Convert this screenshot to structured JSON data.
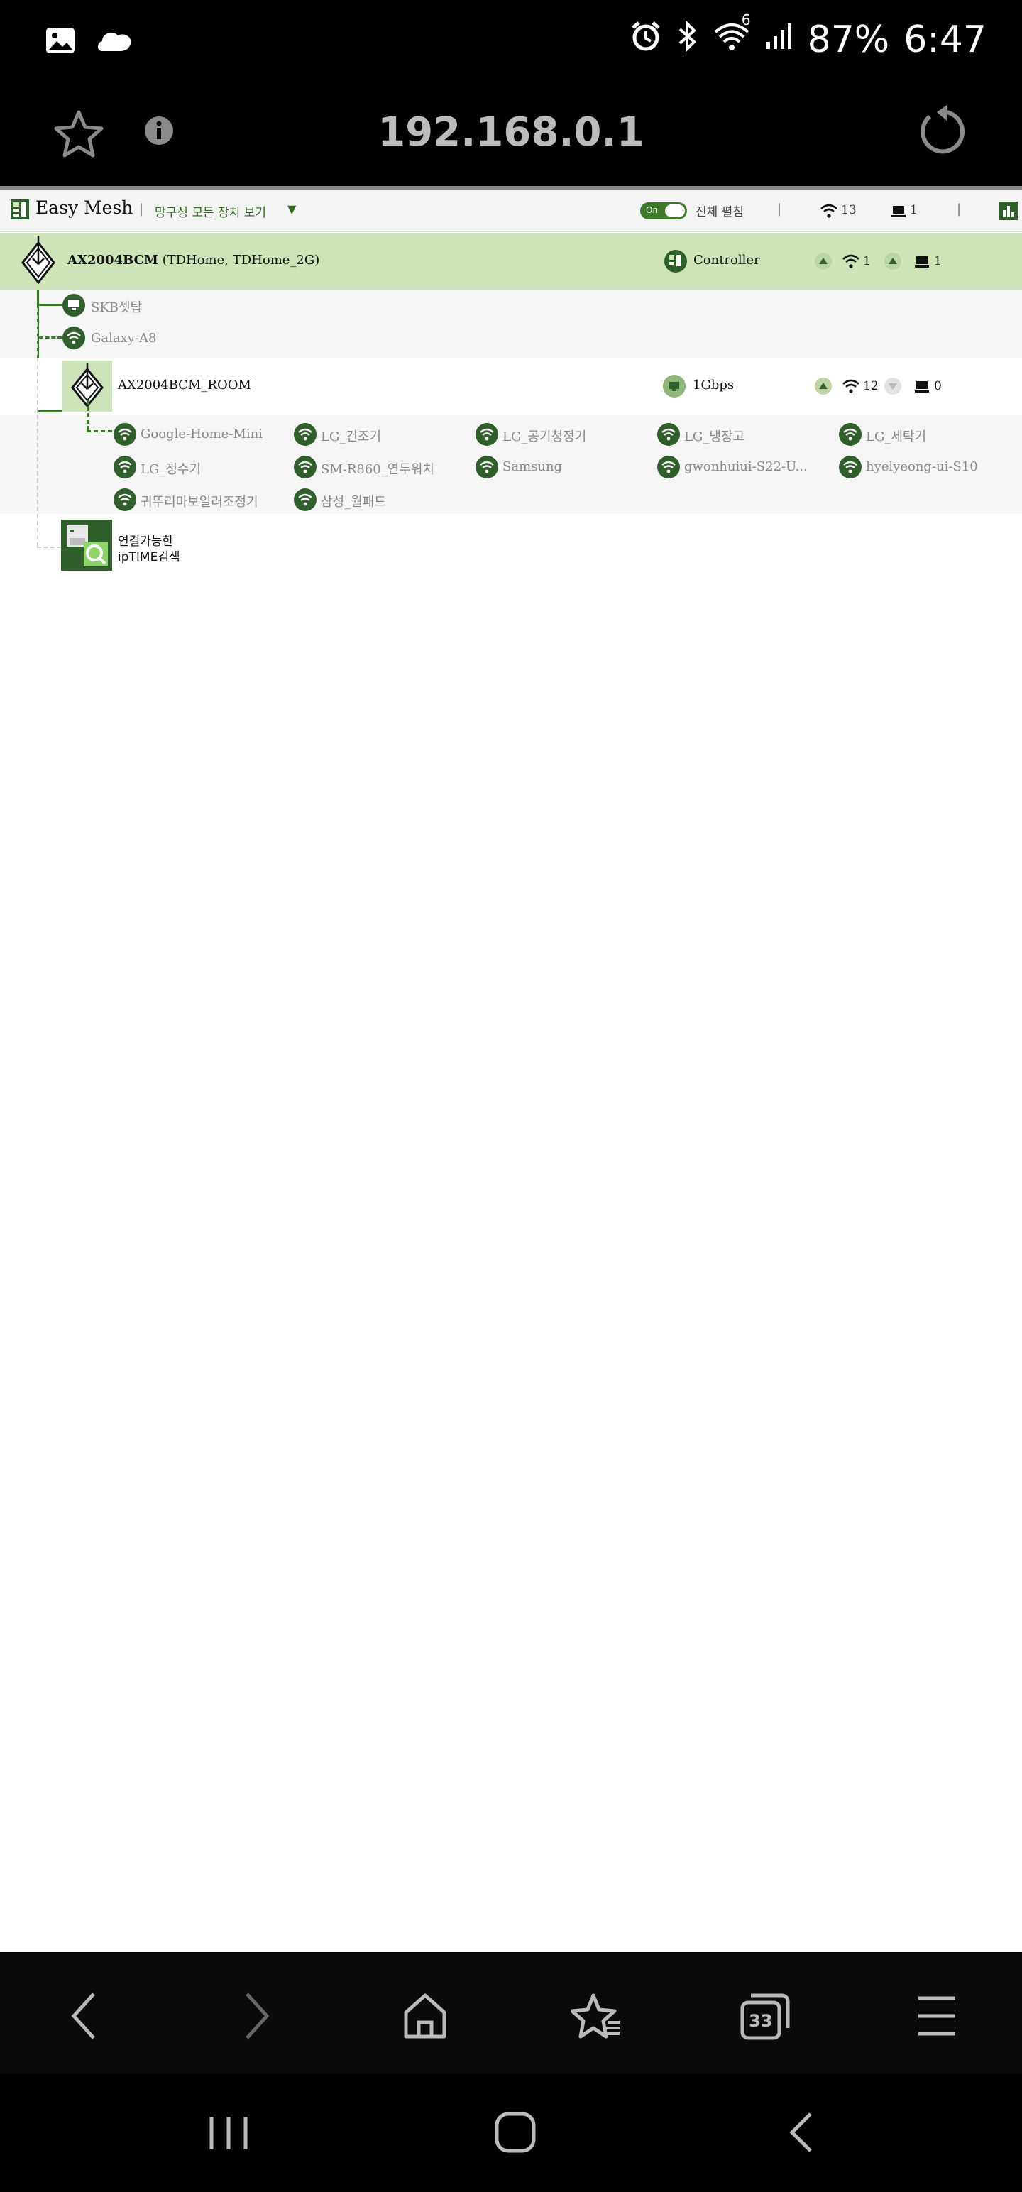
{
  "status_bar": {
    "icons_left": [
      "gallery-icon",
      "cloud-icon"
    ],
    "icons_right": [
      "alarm-icon",
      "bluetooth-icon",
      "wifi-icon",
      "signal-icon"
    ],
    "wifi_badge": "6",
    "battery": "87%",
    "time": "6:47"
  },
  "browser": {
    "url": "192.168.0.1",
    "icons": [
      "star-icon",
      "info-icon",
      "reload-icon"
    ]
  },
  "toolbar": {
    "title": "Easy Mesh",
    "view_label": "망구성 모든 장치 보기",
    "toggle_label": "On",
    "expand_label": "전체 펼침",
    "wifi_count": "13",
    "lan_count": "1"
  },
  "controller": {
    "name": "AX2004BCM",
    "ssids": "(TDHome, TDHome_2G)",
    "role": "Controller",
    "wifi": "1",
    "lan": "1"
  },
  "controller_clients": [
    "SKB셋탑",
    "Galaxy-A8"
  ],
  "agent": {
    "name": "AX2004BCM_ROOM",
    "link": "1Gbps",
    "wifi": "12",
    "lan": "0"
  },
  "agent_clients": [
    "Google-Home-Mini",
    "LG_건조기",
    "LG_공기청정기",
    "LG_냉장고",
    "LG_세탁기",
    "LG_정수기",
    "SM-R860_연두워치",
    "Samsung",
    "gwonhuiui-S22-U...",
    "hyelyeong-ui-S10",
    "귀뚜리마보일러조정기",
    "삼성_월패드"
  ],
  "search": {
    "line1": "연결가능한",
    "line2": "ipTIME검색"
  },
  "nav": {
    "icons": [
      "back-icon",
      "forward-icon",
      "home-icon",
      "bookmarks-icon",
      "tabs-icon",
      "menu-icon"
    ],
    "tabs_count": "33"
  },
  "colors": {
    "accent": "#2f5f2a",
    "highlight_row": "#cfe3b8"
  }
}
